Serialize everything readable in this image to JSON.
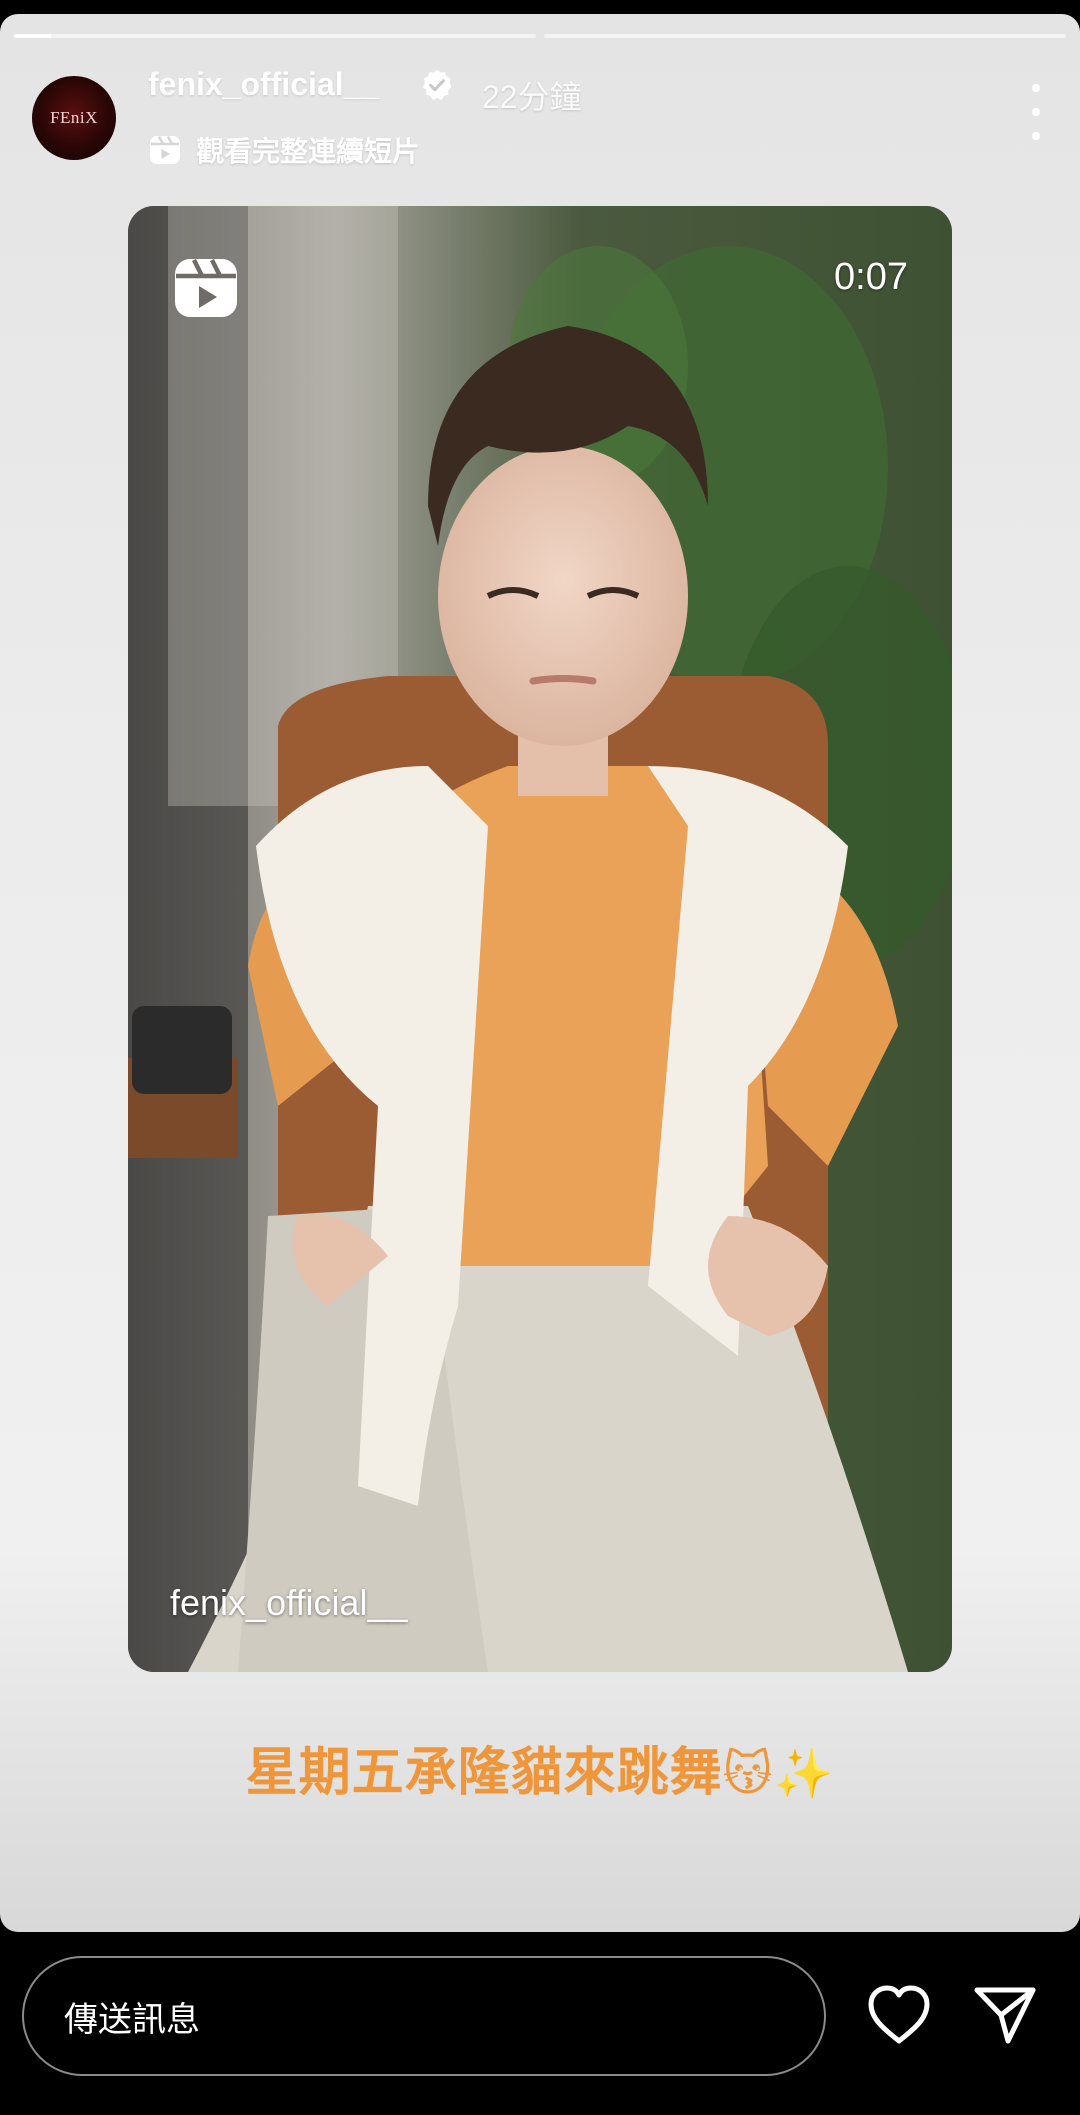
{
  "story": {
    "progress_segments": [
      {
        "fill_fraction": 0.07
      },
      {
        "fill_fraction": 0.0
      }
    ],
    "header": {
      "username": "fenix_official__",
      "verified": true,
      "timestamp": "22分鐘",
      "avatar_logo_text": "FEniX",
      "reels_link_label": "觀看完整連續短片",
      "more_icon": "more-vertical-icon"
    },
    "video": {
      "duration": "0:07",
      "watermark": "fenix_official__",
      "badge_icon": "reels-icon"
    },
    "caption": {
      "text": "星期五承隆貓來跳舞",
      "emojis": "😽✨"
    }
  },
  "reply_bar": {
    "message_placeholder": "傳送訊息",
    "like_icon": "heart-icon",
    "share_icon": "send-icon"
  },
  "colors": {
    "caption_orange": "#f0963a",
    "bottom_bar": "#000000"
  }
}
